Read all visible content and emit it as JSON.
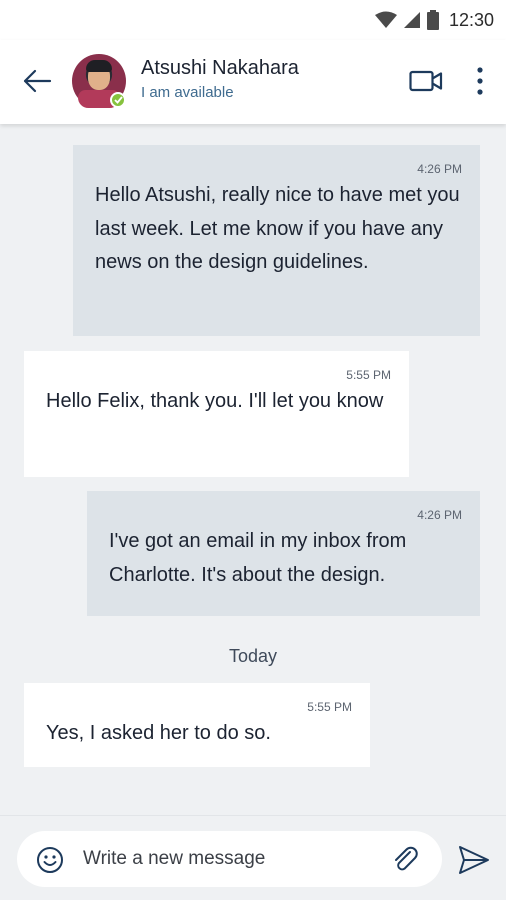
{
  "status_bar": {
    "time": "12:30",
    "icons": [
      "wifi-icon",
      "cell-signal-icon",
      "battery-icon"
    ]
  },
  "header": {
    "contact_name": "Atsushi Nakahara",
    "contact_status": "I am available",
    "icons": [
      "back-arrow-icon",
      "avatar",
      "presence-check-icon",
      "video-call-icon",
      "more-vertical-icon"
    ]
  },
  "conversation": {
    "messages": [
      {
        "direction": "outgoing",
        "time": "4:26 PM",
        "text": "Hello Atsushi, really nice to have met you last week. Let me know if you have any news on the design guidelines."
      },
      {
        "direction": "incoming",
        "time": "5:55 PM",
        "text": "Hello Felix, thank you. I'll let you know"
      },
      {
        "direction": "outgoing",
        "time": "4:26 PM",
        "text": "I've got an email in my inbox from Charlotte. It's about the design."
      },
      {
        "direction": "incoming",
        "time": "5:55 PM",
        "text": "Yes, I asked her to do so."
      }
    ],
    "day_separator": "Today"
  },
  "composer": {
    "placeholder": "Write a new message",
    "value": "",
    "icons": [
      "emoji-icon",
      "paperclip-icon",
      "send-icon"
    ]
  },
  "colors": {
    "outgoing_bubble": "#dde3e8",
    "incoming_bubble": "#ffffff",
    "background": "#eff1f3",
    "status_text": "#3f6b8f",
    "presence": "#86c23e",
    "icon": "#1d3a5c"
  }
}
